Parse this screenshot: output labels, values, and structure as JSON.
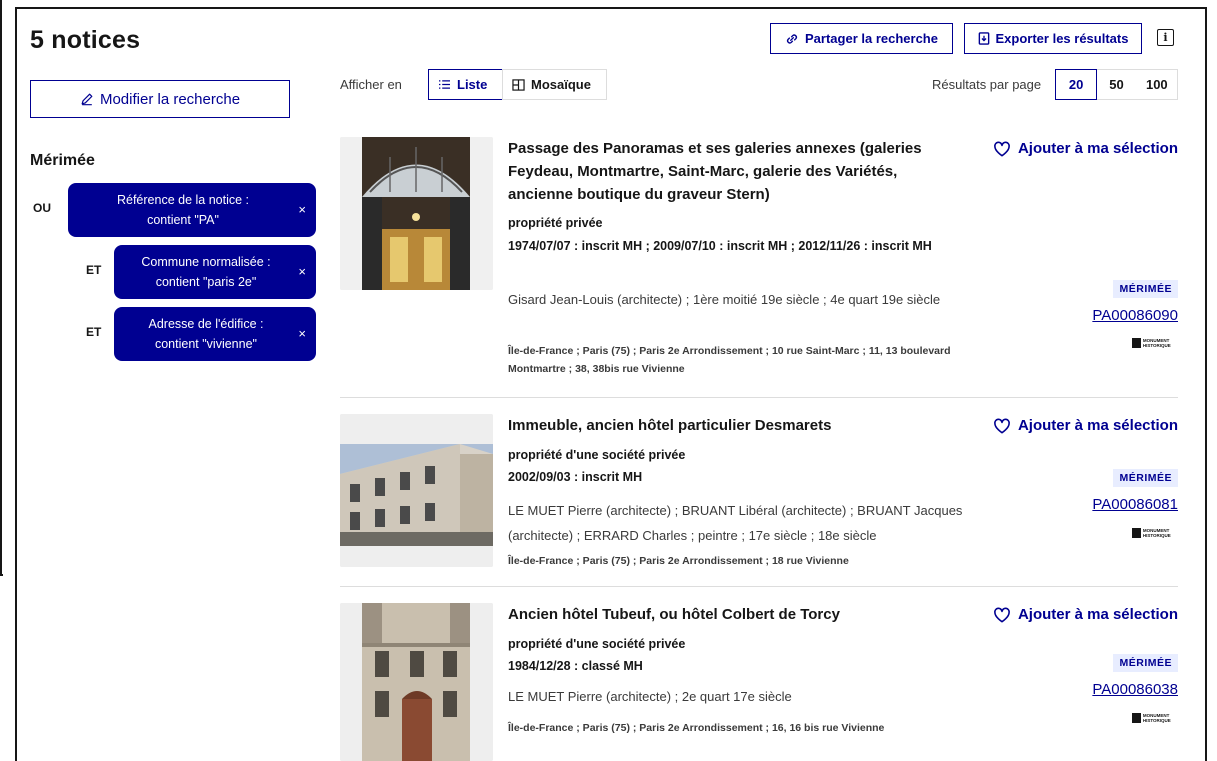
{
  "header": {
    "count_title": "5 notices",
    "share_label": "Partager la recherche",
    "export_label": "Exporter les résultats",
    "info_label": "i"
  },
  "toolbar": {
    "display_label": "Afficher en",
    "list_label": "Liste",
    "mosaic_label": "Mosaïque",
    "per_page_label": "Résultats par page",
    "per_page_options": [
      "20",
      "50",
      "100"
    ]
  },
  "sidebar": {
    "modify_label": "Modifier la recherche",
    "section_title": "Mérimée",
    "filters": [
      {
        "op": "OU",
        "line1": "Référence de la notice :",
        "line2": "contient \"PA\"",
        "close": "×"
      },
      {
        "op": "ET",
        "line1": "Commune normalisée :",
        "line2": "contient \"paris 2e\"",
        "close": "×"
      },
      {
        "op": "ET",
        "line1": "Adresse de l'édifice :",
        "line2": "contient \"vivienne\"",
        "close": "×"
      }
    ]
  },
  "results": [
    {
      "title": "Passage des Panoramas et ses galeries annexes (galeries Feydeau, Montmartre, Saint-Marc, galerie des Variétés, ancienne boutique du graveur Stern)",
      "ownership": "propriété privée",
      "protection": "1974/07/07 : inscrit MH ; 2009/07/10 : inscrit MH ; 2012/11/26 : inscrit MH",
      "description": "Gisard Jean-Louis (architecte) ; 1ère moitié 19e siècle ; 4e quart 19e siècle",
      "address": "Île-de-France ; Paris (75) ; Paris 2e Arrondissement ; 10 rue Saint-Marc ; 11, 13 boulevard Montmartre ; 38, 38bis rue Vivienne",
      "fav_label": "Ajouter à ma sélection",
      "badge": "MÉRIMÉE",
      "reference": "PA00086090",
      "mh_text": "MONUMENT HISTORIQUE"
    },
    {
      "title": "Immeuble, ancien hôtel particulier Desmarets",
      "ownership": "propriété d'une société privée",
      "protection": "2002/09/03 : inscrit MH",
      "description": "LE MUET Pierre (architecte) ; BRUANT Libéral (architecte) ; BRUANT Jacques (architecte) ; ERRARD Charles ; peintre ; 17e siècle ; 18e siècle",
      "address": "Île-de-France ; Paris (75) ; Paris 2e Arrondissement ; 18 rue Vivienne",
      "fav_label": "Ajouter à ma sélection",
      "badge": "MÉRIMÉE",
      "reference": "PA00086081",
      "mh_text": "MONUMENT HISTORIQUE"
    },
    {
      "title": "Ancien hôtel Tubeuf, ou hôtel Colbert de Torcy",
      "ownership": "propriété d'une société privée",
      "protection": "1984/12/28 : classé MH",
      "description": "LE MUET Pierre (architecte) ; 2e quart 17e siècle",
      "address": "Île-de-France ; Paris (75) ; Paris 2e Arrondissement ; 16, 16 bis rue Vivienne",
      "fav_label": "Ajouter à ma sélection",
      "badge": "MÉRIMÉE",
      "reference": "PA00086038",
      "mh_text": "MONUMENT HISTORIQUE"
    }
  ],
  "colors": {
    "primary": "#000091",
    "badge_bg": "#e8edff",
    "text": "#161616"
  },
  "icons": {
    "share": "link-icon",
    "export": "download-file-icon",
    "modify": "pencil-icon",
    "list": "list-icon",
    "mosaic": "grid-icon",
    "favorite": "heart-icon",
    "close": "close-icon"
  }
}
